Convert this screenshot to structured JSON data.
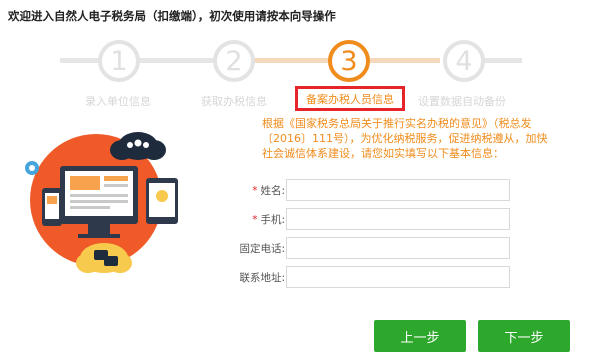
{
  "header": {
    "title": "欢迎进入自然人电子税务局（扣缴端），初次使用请按本向导操作"
  },
  "steps": [
    {
      "number": "1",
      "label": "录入单位信息"
    },
    {
      "number": "2",
      "label": "获取办税信息"
    },
    {
      "number": "3",
      "label": "备案办税人员信息"
    },
    {
      "number": "4",
      "label": "设置数据自动备份"
    }
  ],
  "current_step": 3,
  "intro": "根据《国家税务总局关于推行实名办税的意见》（税总发〔2016〕111号），为优化纳税服务，促进纳税遵从，加快社会诚信体系建设，请您如实填写以下基本信息：",
  "form": {
    "name_label": "姓名:",
    "phone_label": "手机:",
    "landline_label": "固定电话:",
    "address_label": "联系地址:",
    "required_mark": "*",
    "name_value": "",
    "phone_value": "",
    "landline_value": "",
    "address_value": ""
  },
  "buttons": {
    "prev": "上一步",
    "next": "下一步"
  },
  "colors": {
    "accent": "#f08c1c",
    "highlight_box": "#e5252a",
    "button": "#2da82d",
    "inactive": "#e3e3e3"
  }
}
